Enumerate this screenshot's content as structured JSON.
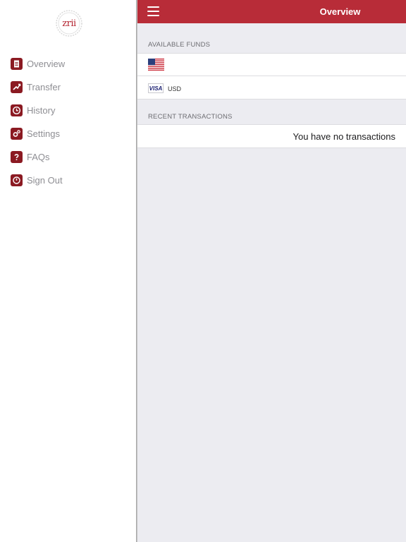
{
  "logo": {
    "text": "zrii"
  },
  "sidebar": {
    "items": [
      {
        "label": "Overview",
        "icon": "document-icon"
      },
      {
        "label": "Transfer",
        "icon": "transfer-icon"
      },
      {
        "label": "History",
        "icon": "history-icon"
      },
      {
        "label": "Settings",
        "icon": "gear-icon"
      },
      {
        "label": "FAQs",
        "icon": "question-icon"
      },
      {
        "label": "Sign Out",
        "icon": "power-icon"
      }
    ]
  },
  "header": {
    "title": "Overview",
    "menu_icon": "hamburger-icon"
  },
  "funds": {
    "section_title": "AVAILABLE FUNDS",
    "rows": [
      {
        "icon": "us-flag-icon"
      },
      {
        "icon": "visa-card-icon",
        "card_text": "VISA",
        "currency": "USD"
      }
    ]
  },
  "transactions": {
    "section_title": "RECENT TRANSACTIONS",
    "empty_message": "You have no transactions"
  },
  "colors": {
    "accent": "#b82c38",
    "icon_bg": "#8b1a22",
    "panel_bg": "#ececf1"
  }
}
